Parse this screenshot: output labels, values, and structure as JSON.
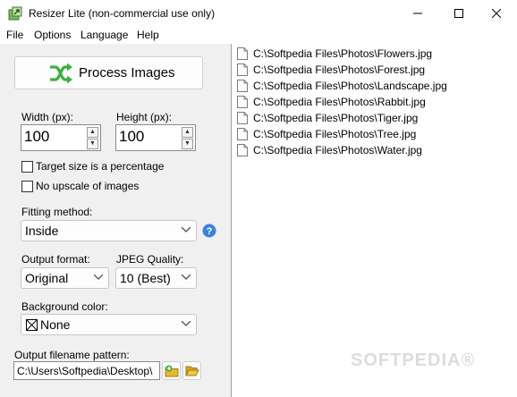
{
  "window": {
    "title": "Resizer Lite (non-commercial use only)"
  },
  "menu": [
    "File",
    "Options",
    "Language",
    "Help"
  ],
  "process_button": {
    "label": "Process Images"
  },
  "size": {
    "width_label": "Width (px):",
    "width_value": "100",
    "height_label": "Height (px):",
    "height_value": "100"
  },
  "checkboxes": {
    "percentage_label": "Target size is a percentage",
    "percentage_checked": false,
    "no_upscale_label": "No upscale of images",
    "no_upscale_checked": false
  },
  "fitting": {
    "label": "Fitting method:",
    "value": "Inside"
  },
  "output_format": {
    "label": "Output format:",
    "value": "Original"
  },
  "jpeg_quality": {
    "label": "JPEG Quality:",
    "value": "10 (Best)"
  },
  "background": {
    "label": "Background color:",
    "value": "None"
  },
  "filename_pattern": {
    "label": "Output filename pattern:",
    "value": "C:\\Users\\Softpedia\\Desktop\\"
  },
  "files": [
    "C:\\Softpedia Files\\Photos\\Flowers.jpg",
    "C:\\Softpedia Files\\Photos\\Forest.jpg",
    "C:\\Softpedia Files\\Photos\\Landscape.jpg",
    "C:\\Softpedia Files\\Photos\\Rabbit.jpg",
    "C:\\Softpedia Files\\Photos\\Tiger.jpg",
    "C:\\Softpedia Files\\Photos\\Tree.jpg",
    "C:\\Softpedia Files\\Photos\\Water.jpg"
  ],
  "watermark": "SOFTPEDIA®",
  "colors": {
    "process_icon_green": "#3cb043",
    "help_icon_blue": "#3d82d6",
    "folder_icon_yellow": "#e8b82e"
  },
  "icons": {
    "process": "shuffle-arrows-icon",
    "help": "question-mark-icon",
    "pattern_builder": "folder-star-icon",
    "browse": "folder-open-icon",
    "file": "file-icon"
  }
}
